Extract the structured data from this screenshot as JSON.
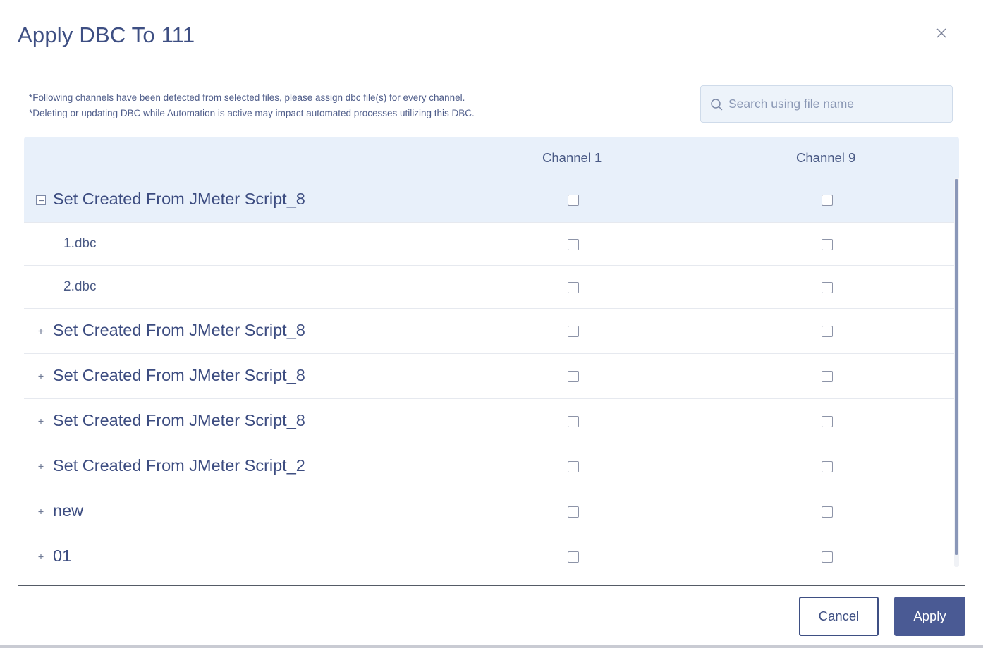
{
  "dialog": {
    "title": "Apply DBC To 111",
    "close_icon": "close-icon",
    "notes": [
      "*Following channels have been detected from selected files, please assign dbc file(s) for every channel.",
      "*Deleting or updating DBC while Automation is active may impact automated processes utilizing this DBC."
    ]
  },
  "search": {
    "placeholder": "Search using file name",
    "value": "",
    "icon": "search-icon"
  },
  "table": {
    "columns": [
      "Channel 1",
      "Channel 9"
    ],
    "rows": [
      {
        "type": "group",
        "label": "Set Created From JMeter Script_8",
        "expanded": true,
        "active": true
      },
      {
        "type": "child",
        "label": "1.dbc"
      },
      {
        "type": "child",
        "label": "2.dbc"
      },
      {
        "type": "group",
        "label": "Set Created From JMeter Script_8",
        "expanded": false
      },
      {
        "type": "group",
        "label": "Set Created From JMeter Script_8",
        "expanded": false
      },
      {
        "type": "group",
        "label": "Set Created From JMeter Script_8",
        "expanded": false
      },
      {
        "type": "group",
        "label": "Set Created From JMeter Script_2",
        "expanded": false
      },
      {
        "type": "group",
        "label": "new",
        "expanded": false
      },
      {
        "type": "group",
        "label": "01",
        "expanded": false
      }
    ]
  },
  "footer": {
    "cancel_label": "Cancel",
    "apply_label": "Apply"
  },
  "colors": {
    "primary": "#3e4f83",
    "apply_bg": "#4a5a94",
    "header_bg": "#e8f0fa",
    "search_bg": "#edf3fa"
  }
}
